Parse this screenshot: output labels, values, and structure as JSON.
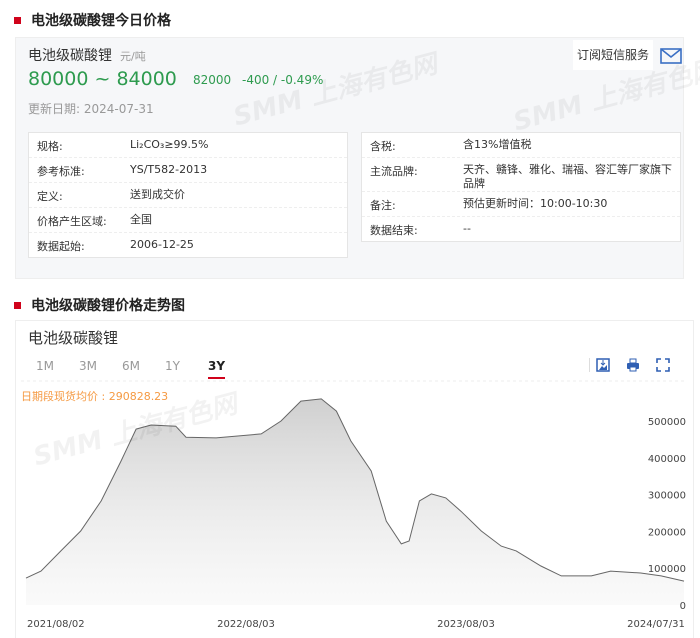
{
  "section1_title": "电池级碳酸锂今日价格",
  "product": {
    "name": "电池级碳酸锂",
    "unit": "元/吨",
    "range": "80000 ~ 84000",
    "mid": "82000",
    "change": "-400 / -0.49%",
    "update": "更新日期: 2024-07-31",
    "subscribe": "订阅短信服务"
  },
  "left_table": [
    {
      "k": "规格:",
      "v": "Li₂CO₃≥99.5%"
    },
    {
      "k": "参考标准:",
      "v": "YS/T582-2013"
    },
    {
      "k": "定义:",
      "v": "送到成交价"
    },
    {
      "k": "价格产生区域:",
      "v": "全国"
    },
    {
      "k": "数据起始:",
      "v": "2006-12-25"
    }
  ],
  "right_table": [
    {
      "k": "含税:",
      "v": "含13%增值税"
    },
    {
      "k": "主流品牌:",
      "v": "天齐、赣锋、雅化、瑞福、容汇等厂家旗下品牌"
    },
    {
      "k": "备注:",
      "v": "预估更新时间：10:00-10:30"
    },
    {
      "k": "数据结束:",
      "v": "--"
    }
  ],
  "section2_title": "电池级碳酸锂价格走势图",
  "watermark": "SMM 上海有色网",
  "chart_data": {
    "type": "area",
    "title": "电池级碳酸锂",
    "tabs": [
      "1M",
      "3M",
      "6M",
      "1Y",
      "3Y"
    ],
    "active_tab": "3Y",
    "avg_label": "日期段现货均价 : 290828.23",
    "ylim": [
      0,
      550000
    ],
    "yticks": [
      0,
      100000,
      200000,
      300000,
      400000,
      500000
    ],
    "xticks": [
      "2021/08/02",
      "2022/08/03",
      "2023/08/03",
      "2024/07/31"
    ],
    "xrange": [
      "2021-08-02",
      "2024-07-31"
    ],
    "points": [
      [
        "2021-08-02",
        73000
      ],
      [
        "2021-08-27",
        92000
      ],
      [
        "2021-09-29",
        147000
      ],
      [
        "2021-11-01",
        201000
      ],
      [
        "2021-12-05",
        283000
      ],
      [
        "2022-01-07",
        391000
      ],
      [
        "2022-02-01",
        478000
      ],
      [
        "2022-02-26",
        489000
      ],
      [
        "2022-04-08",
        486000
      ],
      [
        "2022-04-25",
        456000
      ],
      [
        "2022-06-14",
        454000
      ],
      [
        "2022-08-28",
        465000
      ],
      [
        "2022-09-30",
        500000
      ],
      [
        "2022-11-02",
        554000
      ],
      [
        "2022-12-06",
        560000
      ],
      [
        "2022-12-31",
        527000
      ],
      [
        "2023-01-24",
        446000
      ],
      [
        "2023-02-27",
        364000
      ],
      [
        "2023-03-24",
        228000
      ],
      [
        "2023-04-18",
        166000
      ],
      [
        "2023-05-01",
        174000
      ],
      [
        "2023-05-18",
        283000
      ],
      [
        "2023-06-07",
        302000
      ],
      [
        "2023-07-01",
        291000
      ],
      [
        "2023-07-26",
        255000
      ],
      [
        "2023-08-29",
        201000
      ],
      [
        "2023-10-01",
        160000
      ],
      [
        "2023-10-26",
        147000
      ],
      [
        "2023-12-06",
        106000
      ],
      [
        "2024-01-09",
        79000
      ],
      [
        "2024-02-28",
        79000
      ],
      [
        "2024-03-31",
        92000
      ],
      [
        "2024-05-20",
        87000
      ],
      [
        "2024-06-23",
        79000
      ],
      [
        "2024-07-31",
        65000
      ]
    ]
  }
}
